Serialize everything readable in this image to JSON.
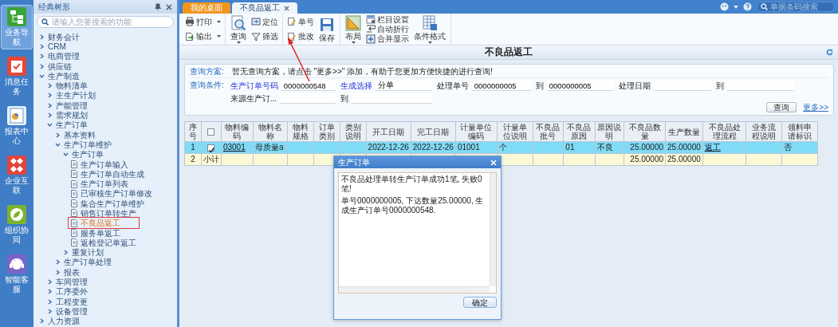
{
  "rail": [
    {
      "label": "业务导航",
      "selected": true
    },
    {
      "label": "消息任务",
      "selected": false
    },
    {
      "label": "报表中心",
      "selected": false
    },
    {
      "label": "企业互联",
      "selected": false
    },
    {
      "label": "组织协同",
      "selected": false
    },
    {
      "label": "智能客服",
      "selected": false
    }
  ],
  "sidebar": {
    "title": "经典树形",
    "search_placeholder": "请输入您要搜索的功能",
    "tree": [
      {
        "label": "财务会计",
        "kind": "folder",
        "expanded": false
      },
      {
        "label": "CRM",
        "kind": "folder",
        "expanded": false
      },
      {
        "label": "电商管理",
        "kind": "folder",
        "expanded": false
      },
      {
        "label": "供应链",
        "kind": "folder",
        "expanded": false
      },
      {
        "label": "生产制造",
        "kind": "folder",
        "expanded": true,
        "children": [
          {
            "label": "物料清单",
            "kind": "folder",
            "expanded": false
          },
          {
            "label": "主生产计划",
            "kind": "folder",
            "expanded": false
          },
          {
            "label": "产能管理",
            "kind": "folder",
            "expanded": false
          },
          {
            "label": "需求规划",
            "kind": "folder",
            "expanded": false
          },
          {
            "label": "生产订单",
            "kind": "folder",
            "expanded": true,
            "children": [
              {
                "label": "基本资料",
                "kind": "folder",
                "expanded": false
              },
              {
                "label": "生产订单维护",
                "kind": "folder",
                "expanded": true,
                "children": [
                  {
                    "label": "生产订单",
                    "kind": "folder",
                    "expanded": true,
                    "children": [
                      {
                        "label": "生产订单输入",
                        "kind": "page",
                        "selected": false
                      },
                      {
                        "label": "生产订单自动生成",
                        "kind": "page",
                        "selected": false
                      },
                      {
                        "label": "生产订单列表",
                        "kind": "page",
                        "selected": false
                      },
                      {
                        "label": "已审核生产订单修改",
                        "kind": "page",
                        "selected": false
                      },
                      {
                        "label": "集合生产订单维护",
                        "kind": "page",
                        "selected": false
                      },
                      {
                        "label": "销售订单转生产",
                        "kind": "page",
                        "selected": false
                      },
                      {
                        "label": "不良品返工",
                        "kind": "page",
                        "selected": true
                      },
                      {
                        "label": "服务单返工",
                        "kind": "page",
                        "selected": false
                      },
                      {
                        "label": "返检登记单返工",
                        "kind": "page",
                        "selected": false
                      }
                    ]
                  },
                  {
                    "label": "重复计划",
                    "kind": "folder",
                    "expanded": false
                  }
                ]
              },
              {
                "label": "生产订单处理",
                "kind": "folder",
                "expanded": false
              },
              {
                "label": "报表",
                "kind": "folder",
                "expanded": false
              }
            ]
          },
          {
            "label": "车间管理",
            "kind": "folder",
            "expanded": false
          },
          {
            "label": "工序委外",
            "kind": "folder",
            "expanded": false
          },
          {
            "label": "工程变更",
            "kind": "folder",
            "expanded": false
          },
          {
            "label": "设备管理",
            "kind": "folder",
            "expanded": false
          }
        ]
      },
      {
        "label": "人力资源",
        "kind": "folder",
        "expanded": false
      }
    ]
  },
  "tabs": [
    {
      "label": "我的桌面",
      "selected": false,
      "closable": false
    },
    {
      "label": "不良品返工",
      "selected": true,
      "closable": true
    }
  ],
  "top_search": {
    "placeholder": "单据条码搜索"
  },
  "toolbar": [
    [
      [
        {
          "label": "打印",
          "kind": "small",
          "dropdown": true
        },
        {
          "label": "输出",
          "kind": "small",
          "dropdown": true
        }
      ]
    ],
    [
      [
        {
          "label": "查询",
          "kind": "large",
          "dropdown": true
        }
      ],
      [
        {
          "label": "定位",
          "kind": "small",
          "dropdown": false
        },
        {
          "label": "筛选",
          "kind": "small",
          "dropdown": false
        }
      ]
    ],
    [
      [
        {
          "label": "单号",
          "kind": "small",
          "dropdown": false
        },
        {
          "label": "批改",
          "kind": "small",
          "dropdown": false
        }
      ],
      [
        {
          "label": "保存",
          "kind": "large",
          "dropdown": false
        }
      ]
    ],
    [
      [
        {
          "label": "布局",
          "kind": "large",
          "dropdown": true
        }
      ],
      [
        {
          "label": "栏目设置",
          "kind": "small",
          "dropdown": false
        },
        {
          "label": "自动折行",
          "kind": "small",
          "dropdown": false
        },
        {
          "label": "合并显示",
          "kind": "small",
          "dropdown": false
        }
      ],
      [
        {
          "label": "条件格式",
          "kind": "large",
          "dropdown": true
        }
      ]
    ]
  ],
  "page_title": "不良品返工",
  "query": {
    "scheme_label": "查询方案:",
    "scheme_text": "暂无查询方案，请点击 \"更多>>\" 添加，有助于您更加方便快捷的进行查询!",
    "conditions_label": "查询条件:",
    "fields": [
      [
        {
          "label": "生产订单号码",
          "value": "0000000548",
          "link": true
        },
        {
          "label": "生成选择",
          "value": "分单",
          "link": true
        },
        {
          "label": "处理单号",
          "value": "0000000005",
          "link": false
        },
        {
          "label": "到",
          "value": "0000000005",
          "link": false
        },
        {
          "label": "处理日期",
          "link": false
        },
        {
          "label": "到",
          "link": false
        }
      ],
      [
        {
          "label": "来源生产订...",
          "link": false
        },
        {
          "label": "到",
          "link": false
        }
      ]
    ],
    "search_button": "查询",
    "more_link": "更多>>"
  },
  "table": {
    "header_checked": false,
    "columns": [
      {
        "label": "序号",
        "kind": "index"
      },
      {
        "kind": "check"
      },
      {
        "label": "物料编码",
        "kind": "link"
      },
      {
        "label": "物料名称",
        "kind": "text"
      },
      {
        "label": "物料规格",
        "kind": "text"
      },
      {
        "label": "订单类别",
        "kind": "text"
      },
      {
        "label": "类别说明",
        "kind": "text"
      },
      {
        "label": "开工日期",
        "kind": "date"
      },
      {
        "label": "完工日期",
        "kind": "date"
      },
      {
        "label": "计量单位编码",
        "kind": "text"
      },
      {
        "label": "计量单位说明",
        "kind": "text"
      },
      {
        "label": "不良品批号",
        "kind": "text"
      },
      {
        "label": "不良品原因",
        "kind": "text"
      },
      {
        "label": "原因说明",
        "kind": "text"
      },
      {
        "label": "不良品数量",
        "kind": "number"
      },
      {
        "label": "生产数量",
        "kind": "number"
      },
      {
        "label": "不良品处理流程",
        "kind": "link"
      },
      {
        "label": "业务流程说明",
        "kind": "text"
      },
      {
        "label": "领料申请标识",
        "kind": "text"
      }
    ],
    "rows": [
      {
        "kind": "item",
        "selected": true,
        "checked": true,
        "cells": [
          "1",
          null,
          "03001",
          "母质量a",
          null,
          null,
          null,
          "2022-12-26",
          "2022-12-26",
          "01001",
          "个",
          null,
          "01",
          "不良",
          "25.00000",
          "25.00000",
          "返工",
          null,
          "否"
        ]
      },
      {
        "kind": "subtotal",
        "selected": false,
        "cells": [
          "2",
          "小计",
          null,
          null,
          null,
          null,
          null,
          null,
          null,
          null,
          null,
          null,
          null,
          null,
          "25.00000",
          "25.00000",
          null,
          null,
          null
        ]
      }
    ]
  },
  "dialog": {
    "title": "生产订单",
    "lines": [
      "不良品处理单转生产订单成功1笔, 失败0笔!",
      "单号0000000005, 下达数量25.00000, 生成生产订单号0000000548."
    ],
    "button": "确定"
  }
}
